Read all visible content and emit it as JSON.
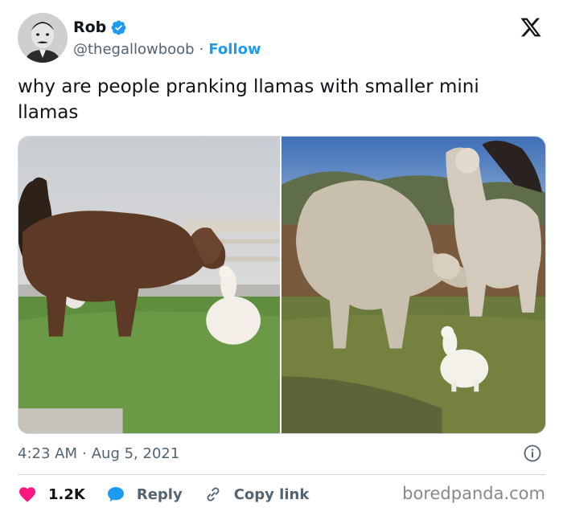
{
  "author": {
    "name": "Rob",
    "handle": "@thegallowboob",
    "separator": "·",
    "follow_label": "Follow",
    "verified": true
  },
  "platform_icon": "x-logo-icon",
  "tweet": {
    "text": "why are people pranking llamas with smaller mini llamas"
  },
  "media": {
    "photo_count": 2
  },
  "meta": {
    "time": "4:23 AM",
    "separator": "·",
    "date": "Aug 5, 2021"
  },
  "actions": {
    "likes": "1.2K",
    "reply_label": "Reply",
    "copy_link_label": "Copy link"
  },
  "watermark": "boredpanda.com",
  "colors": {
    "accent": "#1d9bf0",
    "like": "#f91880",
    "text": "#0f1419",
    "muted": "#536471"
  }
}
